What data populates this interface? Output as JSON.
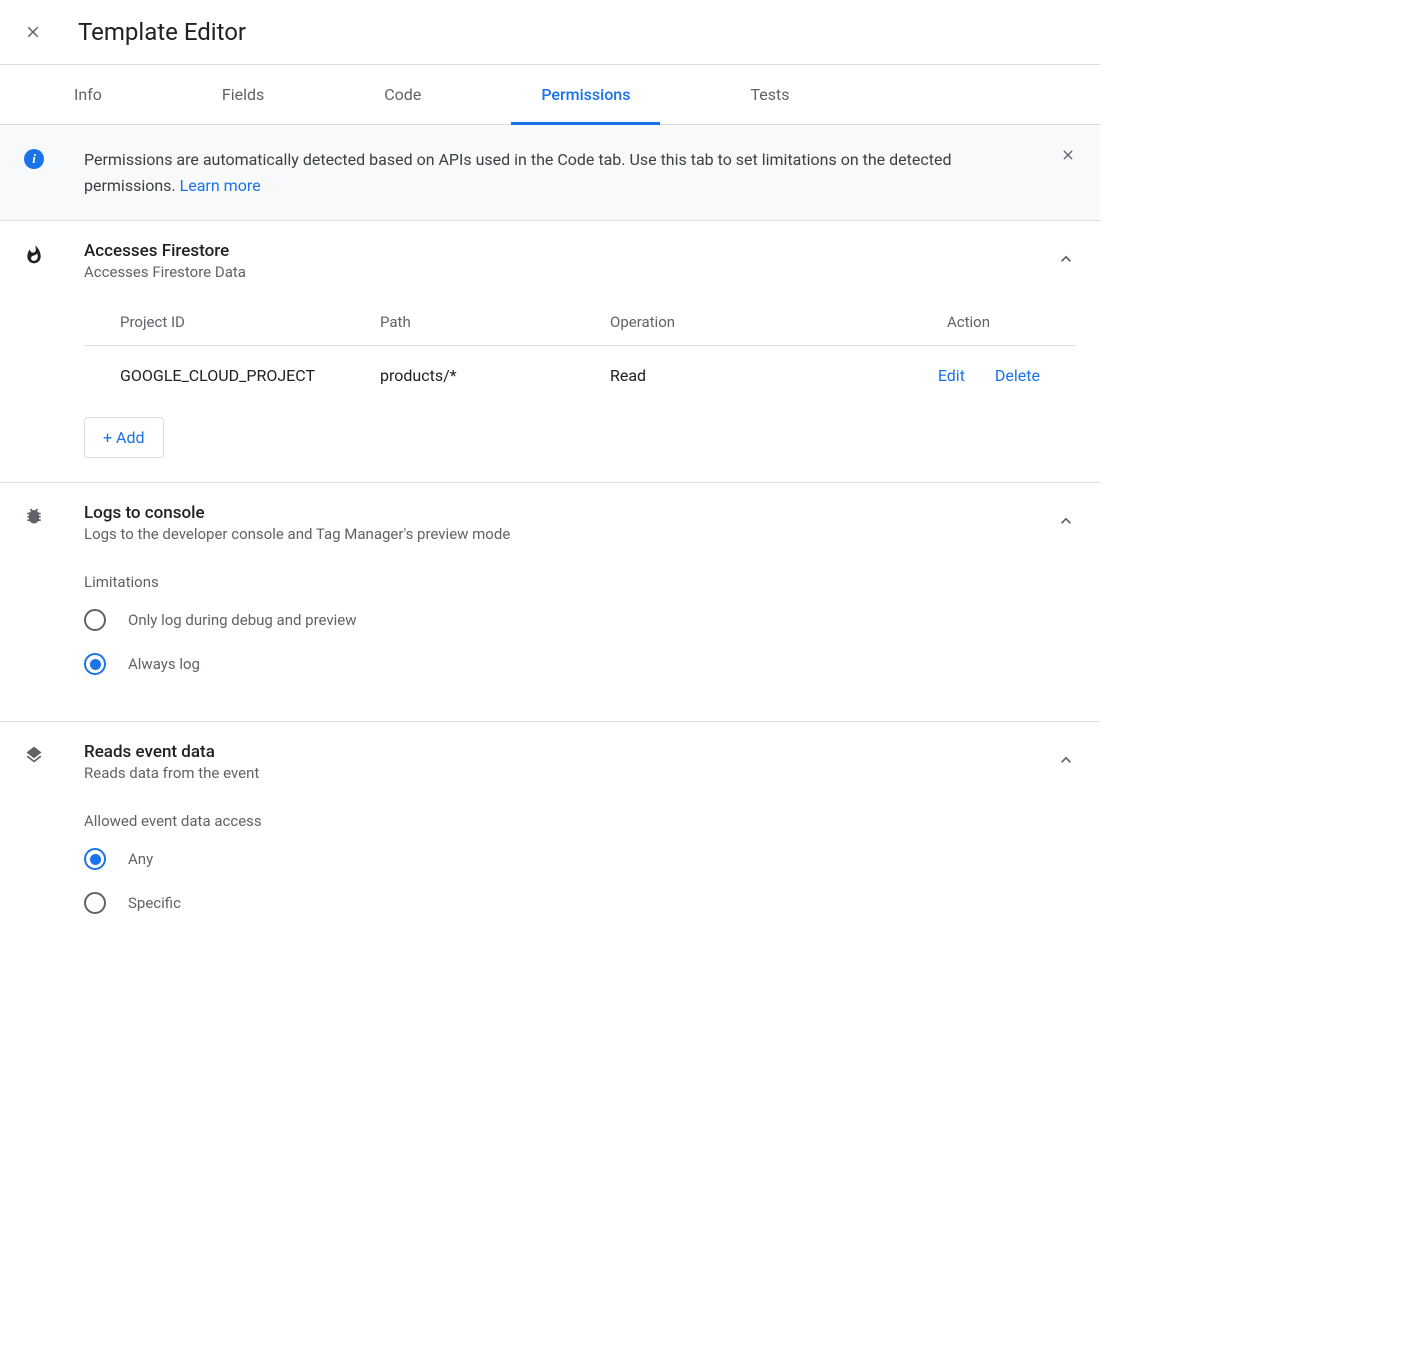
{
  "header": {
    "title": "Template Editor"
  },
  "tabs": [
    {
      "label": "Info",
      "active": false
    },
    {
      "label": "Fields",
      "active": false
    },
    {
      "label": "Code",
      "active": false
    },
    {
      "label": "Permissions",
      "active": true
    },
    {
      "label": "Tests",
      "active": false
    }
  ],
  "banner": {
    "text": "Permissions are automatically detected based on APIs used in the Code tab. Use this tab to set limitations on the detected permissions. ",
    "learn_more": "Learn more"
  },
  "permissions": {
    "firestore": {
      "title": "Accesses Firestore",
      "subtitle": "Accesses Firestore Data",
      "columns": {
        "project_id": "Project ID",
        "path": "Path",
        "operation": "Operation",
        "action": "Action"
      },
      "rows": [
        {
          "project_id": "GOOGLE_CLOUD_PROJECT",
          "path": "products/*",
          "operation": "Read"
        }
      ],
      "actions": {
        "edit": "Edit",
        "delete": "Delete"
      },
      "add_label": "+ Add"
    },
    "logs": {
      "title": "Logs to console",
      "subtitle": "Logs to the developer console and Tag Manager's preview mode",
      "limitations_label": "Limitations",
      "options": [
        {
          "label": "Only log during debug and preview",
          "selected": false
        },
        {
          "label": "Always log",
          "selected": true
        }
      ]
    },
    "event_data": {
      "title": "Reads event data",
      "subtitle": "Reads data from the event",
      "allowed_label": "Allowed event data access",
      "options": [
        {
          "label": "Any",
          "selected": true
        },
        {
          "label": "Specific",
          "selected": false
        }
      ]
    }
  }
}
